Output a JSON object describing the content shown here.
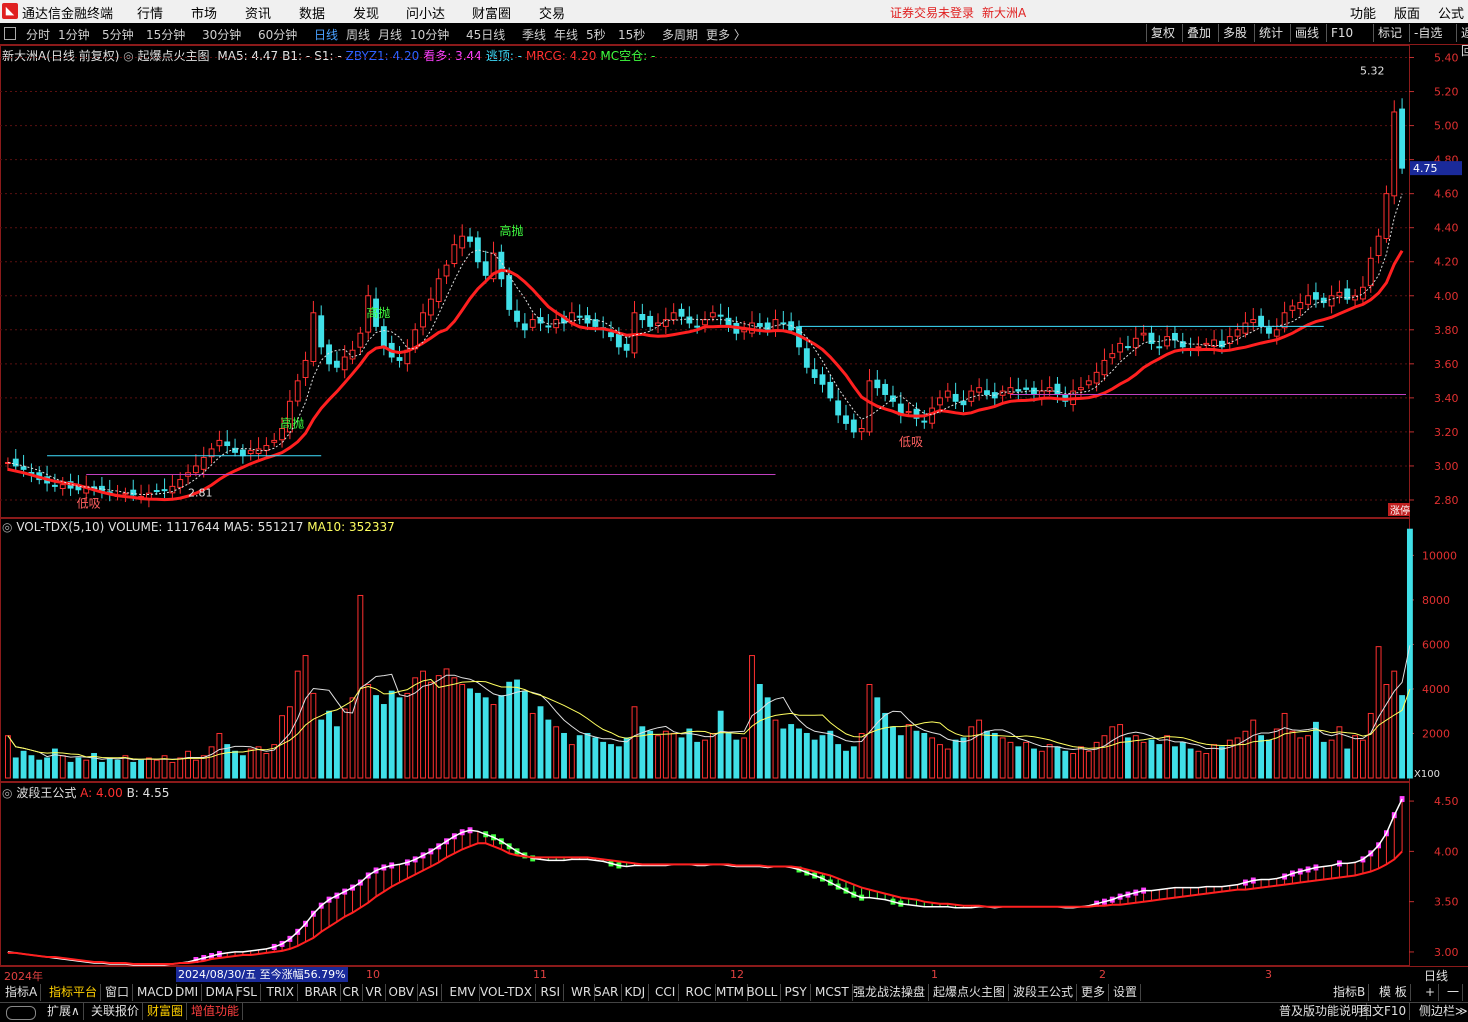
{
  "app": {
    "title": "通达信金融终端",
    "login_status": "证券交易未登录",
    "stock": "新大洲A"
  },
  "menu": {
    "items": [
      "行情",
      "市场",
      "资讯",
      "数据",
      "发现",
      "问小达",
      "财富圈",
      "交易"
    ],
    "right": [
      "功能",
      "版面",
      "公式"
    ]
  },
  "toolbar": {
    "periods": [
      "分时",
      "1分钟",
      "5分钟",
      "15分钟",
      "30分钟",
      "60分钟",
      "日线",
      "周线",
      "月线",
      "10分钟",
      "45日线",
      "季线",
      "年线",
      "5秒",
      "15秒",
      "多周期",
      "更多 〉"
    ],
    "active": "日线",
    "right": [
      "复权",
      "叠加",
      "多股",
      "统计",
      "画线",
      "F10",
      "标记",
      "-自选",
      "返回"
    ]
  },
  "main_chart": {
    "stock_label": "新大洲A(日线 前复权)",
    "formula": "起爆点火主图",
    "indicators": [
      {
        "text": "MA5: 4.47",
        "color": "#e0e0e0"
      },
      {
        "text": "B1: -",
        "color": "#e0e0e0"
      },
      {
        "text": "S1: -",
        "color": "#e0e0e0"
      },
      {
        "text": "ZBYZ1: 4.20",
        "color": "#3060ff"
      },
      {
        "text": "看多: 3.44",
        "color": "#ff40ff"
      },
      {
        "text": "逃顶: -",
        "color": "#40e0ff"
      },
      {
        "text": "MRCG: 4.20",
        "color": "#ff3030"
      },
      {
        "text": "MC空仓: -",
        "color": "#40ff40"
      }
    ],
    "price_ticks": [
      "5.40",
      "5.20",
      "5.00",
      "4.80",
      "4.60",
      "4.40",
      "4.20",
      "4.00",
      "3.80",
      "3.60",
      "3.40",
      "3.20",
      "3.00",
      "2.80"
    ],
    "high_label": "5.32",
    "current_price": "4.75",
    "limit_tag": "涨停",
    "annotations": [
      {
        "text": "高抛",
        "kind": "sell"
      },
      {
        "text": "高抛",
        "kind": "sell"
      },
      {
        "text": "高抛",
        "kind": "sell"
      },
      {
        "text": "低吸",
        "kind": "buy"
      },
      {
        "text": "低吸",
        "kind": "buy"
      }
    ],
    "low_label": "2.81"
  },
  "volume_chart": {
    "label": "VOL-TDX(5,10)",
    "volume": "VOLUME: 1117644",
    "ma5": "MA5: 551217",
    "ma10": "MA10: 352337",
    "ticks": [
      "10000",
      "8000",
      "6000",
      "4000",
      "2000"
    ],
    "unit": "X100"
  },
  "wave_chart": {
    "label": "波段王公式",
    "a": "A: 4.00",
    "b": "B: 4.55",
    "ticks": [
      "4.50",
      "4.00",
      "3.50",
      "3.00"
    ]
  },
  "time_axis": {
    "year": "2024年",
    "cursor": "2024/08/30/五",
    "gain": "至今涨幅56.79%",
    "months": [
      "10",
      "11",
      "12",
      "1",
      "2",
      "3"
    ],
    "period": "日线"
  },
  "tabs1": [
    "指标A",
    "指标平台",
    "窗口",
    "MACD",
    "DMI",
    "DMA",
    "FSL",
    "TRIX",
    "BRAR",
    "CR",
    "VR",
    "OBV",
    "ASI",
    "EMV",
    "VOL-TDX",
    "RSI",
    "WR",
    "SAR",
    "KDJ",
    "CCI",
    "ROC",
    "MTM",
    "BOLL",
    "PSY",
    "MCST",
    "强龙战法操盘",
    "起爆点火主图",
    "波段王公式",
    "更多",
    "设置"
  ],
  "tabs1_right": [
    "指标B",
    "模 板",
    "+",
    "一"
  ],
  "tabs2": [
    "扩展∧",
    "关联报价",
    "财富圈",
    "增值功能"
  ],
  "tabs2_right": [
    "普及版功能说明",
    "图文F10",
    "侧边栏≫"
  ],
  "chart_data": [
    {
      "type": "candlestick",
      "title": "新大洲A(日线 前复权)",
      "ylim": [
        2.7,
        5.45
      ],
      "close": [
        3.02,
        3.0,
        2.98,
        2.95,
        2.92,
        2.9,
        2.88,
        2.89,
        2.87,
        2.86,
        2.88,
        2.86,
        2.85,
        2.84,
        2.83,
        2.84,
        2.83,
        2.82,
        2.84,
        2.85,
        2.86,
        2.88,
        2.92,
        2.96,
        3.0,
        3.05,
        3.1,
        3.15,
        3.12,
        3.08,
        3.06,
        3.09,
        3.1,
        3.12,
        3.15,
        3.22,
        3.38,
        3.5,
        3.62,
        3.9,
        3.7,
        3.6,
        3.58,
        3.64,
        3.68,
        3.78,
        4.0,
        3.82,
        3.7,
        3.64,
        3.62,
        3.68,
        3.8,
        3.9,
        3.98,
        4.1,
        4.18,
        4.3,
        4.35,
        4.32,
        4.2,
        4.12,
        4.25,
        4.1,
        3.92,
        3.85,
        3.8,
        3.86,
        3.84,
        3.82,
        3.86,
        3.84,
        3.9,
        3.88,
        3.84,
        3.82,
        3.8,
        3.76,
        3.7,
        3.68,
        3.9,
        3.86,
        3.82,
        3.84,
        3.86,
        3.9,
        3.88,
        3.84,
        3.82,
        3.86,
        3.9,
        3.88,
        3.82,
        3.78,
        3.8,
        3.84,
        3.82,
        3.8,
        3.86,
        3.84,
        3.8,
        3.7,
        3.58,
        3.52,
        3.48,
        3.4,
        3.3,
        3.25,
        3.2,
        3.22,
        3.5,
        3.46,
        3.42,
        3.38,
        3.3,
        3.32,
        3.28,
        3.26,
        3.34,
        3.4,
        3.44,
        3.38,
        3.36,
        3.44,
        3.46,
        3.42,
        3.4,
        3.44,
        3.46,
        3.44,
        3.45,
        3.42,
        3.44,
        3.46,
        3.42,
        3.38,
        3.44,
        3.46,
        3.5,
        3.55,
        3.62,
        3.66,
        3.72,
        3.7,
        3.75,
        3.78,
        3.72,
        3.7,
        3.76,
        3.74,
        3.7,
        3.68,
        3.7,
        3.72,
        3.74,
        3.7,
        3.76,
        3.8,
        3.84,
        3.86,
        3.82,
        3.78,
        3.8,
        3.9,
        3.94,
        3.96,
        4.0,
        3.98,
        3.96,
        4.0,
        4.02,
        3.98,
        4.0,
        4.05,
        4.22,
        4.35,
        4.6,
        5.08,
        4.75
      ]
    },
    {
      "type": "bar",
      "title": "VOL-TDX(5,10)",
      "ylim": [
        0,
        11500
      ],
      "values": [
        1900,
        900,
        1200,
        1000,
        800,
        900,
        1300,
        1000,
        700,
        900,
        800,
        1100,
        700,
        900,
        800,
        1000,
        700,
        800,
        900,
        800,
        1000,
        700,
        900,
        1200,
        800,
        1000,
        1400,
        2000,
        1500,
        1200,
        1000,
        1300,
        1400,
        1100,
        1500,
        2800,
        3200,
        4800,
        5500,
        3800,
        2600,
        3000,
        2300,
        3100,
        3600,
        8200,
        4200,
        3700,
        3300,
        3900,
        3600,
        3800,
        4500,
        4800,
        4300,
        4600,
        4900,
        4500,
        4200,
        4000,
        3800,
        3600,
        3300,
        3700,
        4300,
        4400,
        3900,
        2900,
        3200,
        2600,
        2300,
        2000,
        1500,
        1900,
        2000,
        1800,
        1600,
        1500,
        1400,
        1800,
        3200,
        2300,
        2100,
        1900,
        2100,
        2000,
        1800,
        2200,
        1600,
        1700,
        2000,
        3000,
        2000,
        1700,
        1800,
        5500,
        4200,
        3600,
        2600,
        2200,
        2400,
        2200,
        2000,
        1700,
        1900,
        2100,
        1500,
        1200,
        1400,
        2000,
        4200,
        3600,
        2900,
        2300,
        1900,
        2400,
        2100,
        2000,
        1800,
        1500,
        1300,
        1700,
        1800,
        2300,
        2600,
        2100,
        2000,
        1800,
        1600,
        1400,
        1600,
        1300,
        1200,
        1500,
        1400,
        1200,
        1100,
        1400,
        1200,
        1600,
        1900,
        2300,
        2400,
        1800,
        1900,
        1600,
        1700,
        1500,
        1900,
        1400,
        1600,
        1300,
        1200,
        1100,
        1500,
        1400,
        1700,
        1800,
        2100,
        2600,
        1900,
        1700,
        2200,
        2900,
        2100,
        1800,
        1900,
        2500,
        1600,
        1700,
        2300,
        1300,
        1900,
        1700,
        2900,
        5900,
        4200,
        4800,
        3700,
        11176
      ]
    },
    {
      "type": "area",
      "title": "波段王公式",
      "ylim": [
        2.9,
        4.65
      ],
      "series": [
        {
          "name": "A",
          "values": [
            3.0,
            2.99,
            2.98,
            2.97,
            2.96,
            2.95,
            2.94,
            2.93,
            2.92,
            2.91,
            2.9,
            2.89,
            2.89,
            2.88,
            2.88,
            2.88,
            2.87,
            2.87,
            2.87,
            2.87,
            2.87,
            2.88,
            2.89,
            2.9,
            2.92,
            2.94,
            2.96,
            2.98,
            2.99,
            3.0,
            3.0,
            3.01,
            3.02,
            3.03,
            3.05,
            3.08,
            3.13,
            3.2,
            3.28,
            3.38,
            3.46,
            3.52,
            3.56,
            3.6,
            3.64,
            3.69,
            3.76,
            3.81,
            3.84,
            3.86,
            3.87,
            3.89,
            3.92,
            3.96,
            4.0,
            4.05,
            4.1,
            4.15,
            4.19,
            4.21,
            4.2,
            4.17,
            4.14,
            4.1,
            4.05,
            4.0,
            3.96,
            3.93,
            3.92,
            3.91,
            3.91,
            3.91,
            3.92,
            3.92,
            3.92,
            3.91,
            3.9,
            3.88,
            3.86,
            3.85,
            3.86,
            3.86,
            3.86,
            3.86,
            3.86,
            3.87,
            3.87,
            3.87,
            3.86,
            3.86,
            3.87,
            3.87,
            3.86,
            3.85,
            3.85,
            3.85,
            3.85,
            3.84,
            3.85,
            3.85,
            3.84,
            3.82,
            3.79,
            3.76,
            3.73,
            3.69,
            3.65,
            3.61,
            3.57,
            3.54,
            3.54,
            3.53,
            3.52,
            3.5,
            3.48,
            3.47,
            3.46,
            3.45,
            3.45,
            3.45,
            3.45,
            3.44,
            3.44,
            3.44,
            3.45,
            3.45,
            3.44,
            3.45,
            3.45,
            3.45,
            3.45,
            3.45,
            3.45,
            3.45,
            3.45,
            3.44,
            3.44,
            3.45,
            3.46,
            3.48,
            3.5,
            3.52,
            3.55,
            3.57,
            3.59,
            3.61,
            3.61,
            3.62,
            3.63,
            3.64,
            3.64,
            3.64,
            3.64,
            3.65,
            3.65,
            3.65,
            3.66,
            3.67,
            3.69,
            3.71,
            3.72,
            3.72,
            3.73,
            3.75,
            3.78,
            3.8,
            3.82,
            3.84,
            3.85,
            3.86,
            3.88,
            3.88,
            3.89,
            3.92,
            3.98,
            4.06,
            4.18,
            4.36,
            4.52
          ]
        },
        {
          "name": "B",
          "values": [
            2.99,
            2.99,
            2.98,
            2.97,
            2.96,
            2.95,
            2.95,
            2.94,
            2.93,
            2.92,
            2.91,
            2.9,
            2.9,
            2.89,
            2.89,
            2.89,
            2.88,
            2.88,
            2.88,
            2.88,
            2.88,
            2.88,
            2.89,
            2.89,
            2.9,
            2.91,
            2.93,
            2.94,
            2.95,
            2.96,
            2.97,
            2.97,
            2.98,
            2.99,
            3.0,
            3.01,
            3.03,
            3.06,
            3.1,
            3.14,
            3.2,
            3.25,
            3.3,
            3.35,
            3.39,
            3.44,
            3.49,
            3.55,
            3.6,
            3.65,
            3.69,
            3.73,
            3.77,
            3.81,
            3.85,
            3.89,
            3.94,
            3.98,
            4.02,
            4.05,
            4.08,
            4.08,
            4.05,
            4.02,
            3.98,
            3.96,
            3.95,
            3.94,
            3.94,
            3.94,
            3.94,
            3.94,
            3.94,
            3.94,
            3.94,
            3.93,
            3.92,
            3.91,
            3.9,
            3.89,
            3.88,
            3.87,
            3.87,
            3.87,
            3.87,
            3.87,
            3.87,
            3.87,
            3.87,
            3.87,
            3.87,
            3.87,
            3.87,
            3.86,
            3.86,
            3.86,
            3.86,
            3.85,
            3.85,
            3.85,
            3.85,
            3.84,
            3.82,
            3.8,
            3.78,
            3.76,
            3.73,
            3.7,
            3.67,
            3.64,
            3.62,
            3.6,
            3.58,
            3.56,
            3.54,
            3.53,
            3.52,
            3.5,
            3.49,
            3.48,
            3.48,
            3.47,
            3.46,
            3.46,
            3.46,
            3.45,
            3.45,
            3.45,
            3.45,
            3.45,
            3.45,
            3.45,
            3.45,
            3.45,
            3.45,
            3.45,
            3.45,
            3.45,
            3.45,
            3.46,
            3.46,
            3.47,
            3.47,
            3.48,
            3.49,
            3.5,
            3.51,
            3.52,
            3.53,
            3.54,
            3.55,
            3.56,
            3.57,
            3.58,
            3.59,
            3.6,
            3.61,
            3.62,
            3.62,
            3.63,
            3.64,
            3.65,
            3.66,
            3.67,
            3.68,
            3.69,
            3.7,
            3.71,
            3.72,
            3.73,
            3.74,
            3.75,
            3.76,
            3.78,
            3.8,
            3.83,
            3.87,
            3.92,
            4.0
          ]
        }
      ]
    }
  ]
}
